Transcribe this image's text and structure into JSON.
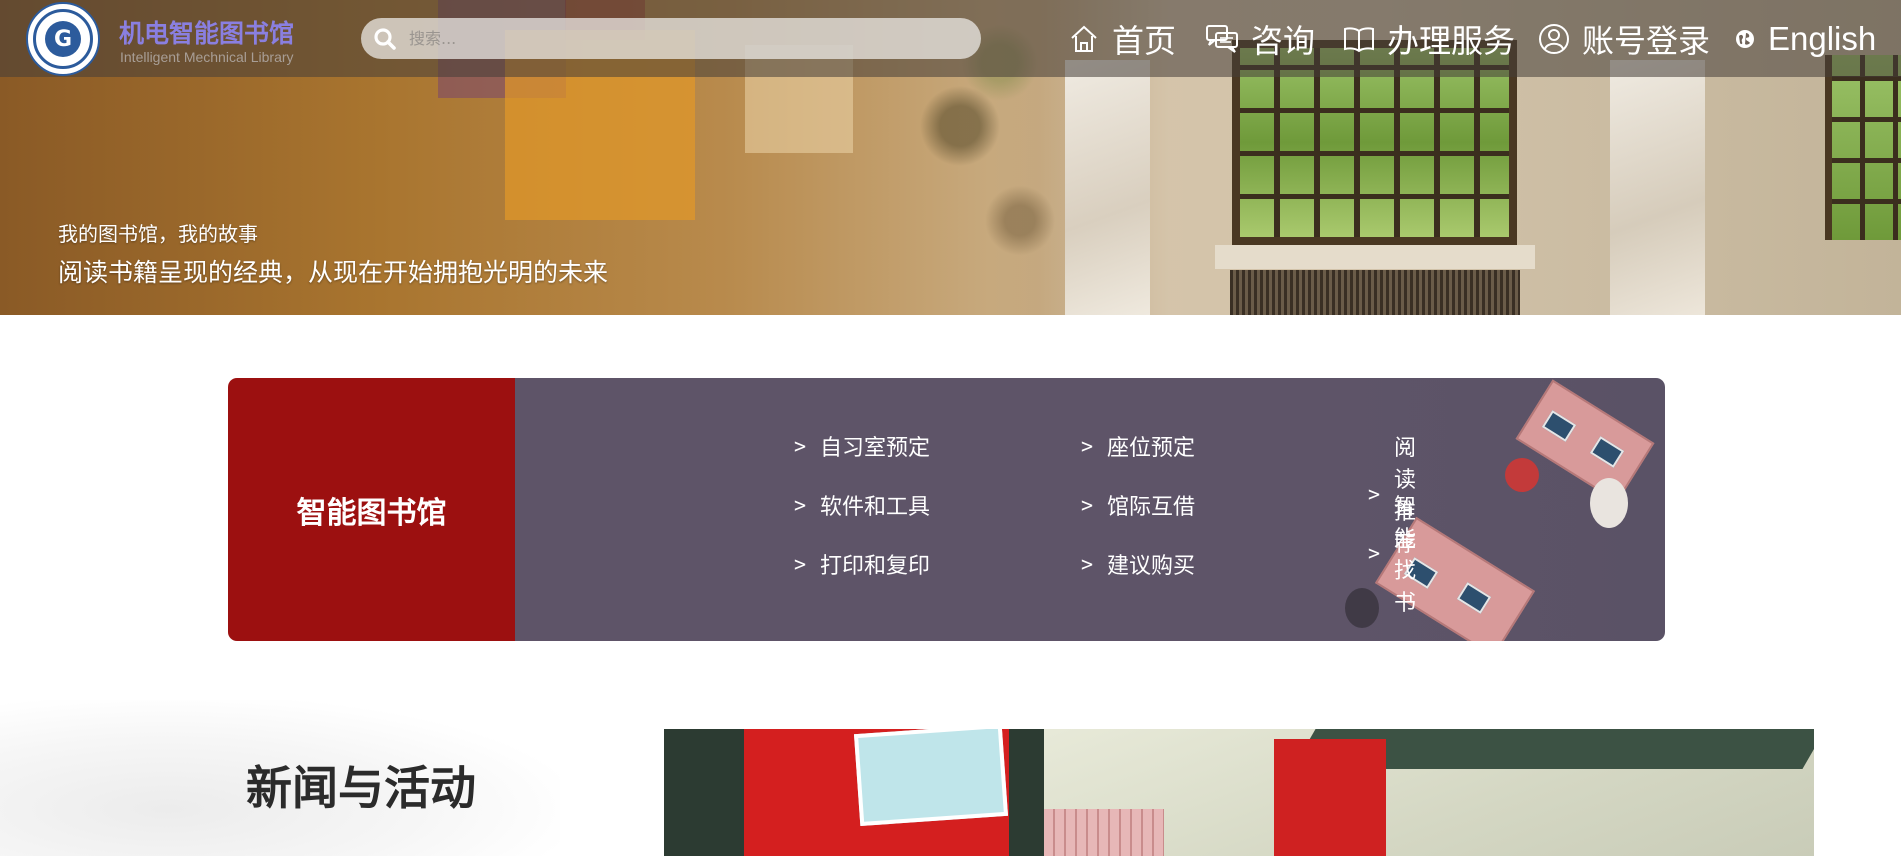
{
  "brand": {
    "name_cn": "机电智能图书馆",
    "name_en": "Intelligent Mechnical Library"
  },
  "search": {
    "placeholder": "搜索..."
  },
  "nav": {
    "home": "首页",
    "consult": "咨询",
    "service": "办理服务",
    "login": "账号登录",
    "language": "English"
  },
  "hero": {
    "subtitle": "我的图书馆，我的故事",
    "title": "阅读书籍呈现的经典，从现在开始拥抱光明的未来"
  },
  "smart_library": {
    "heading": "智能图书馆",
    "arrow": ">",
    "links": [
      "自习室预定",
      "座位预定",
      "阅读推荐",
      "软件和工具",
      "馆际互借",
      "智能找书",
      "打印和复印",
      "建议购买"
    ]
  },
  "news": {
    "heading": "新闻与活动"
  },
  "colors": {
    "brand_text": "#8a7fe0",
    "panel_red": "#9c1010",
    "panel_purple": "#5e5468"
  }
}
